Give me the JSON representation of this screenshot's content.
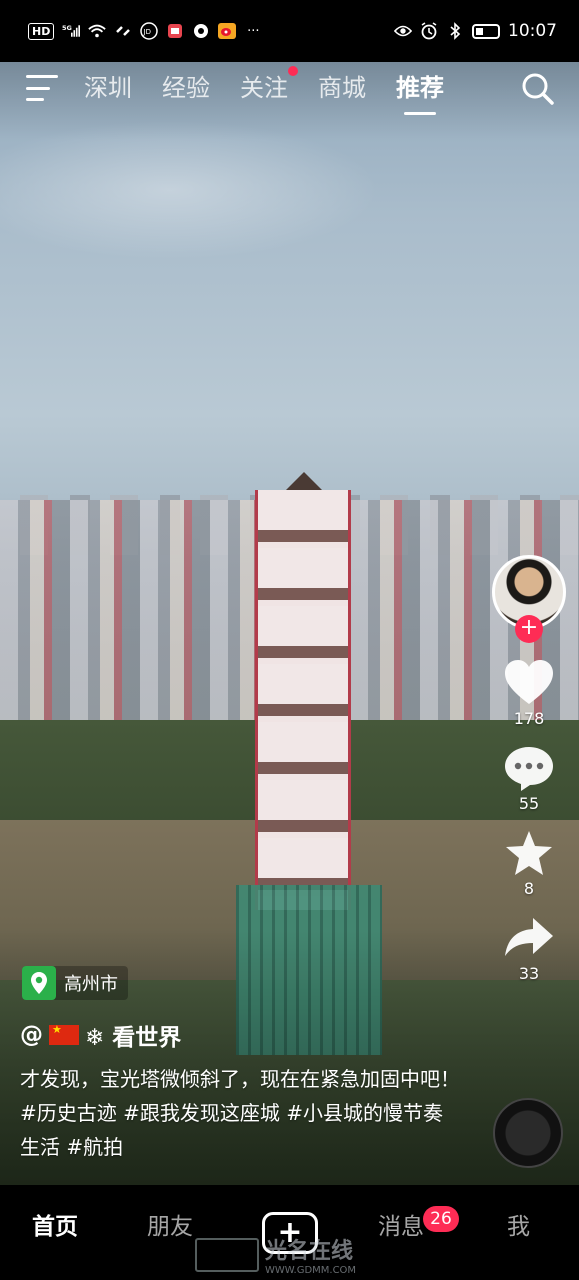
{
  "status_bar": {
    "chips": [
      "HD",
      "5G"
    ],
    "time": "10:07",
    "icons": [
      "signal-icon",
      "wifi-icon",
      "link-icon",
      "jd-icon",
      "app-icon",
      "app-icon",
      "weibo-icon",
      "more-icon",
      "eye-icon",
      "alarm-icon",
      "bluetooth-icon",
      "battery-icon"
    ],
    "more": "···"
  },
  "top_nav": {
    "tabs": [
      {
        "label": "深圳",
        "active": false,
        "dot": false
      },
      {
        "label": "经验",
        "active": false,
        "dot": false
      },
      {
        "label": "关注",
        "active": false,
        "dot": true
      },
      {
        "label": "商城",
        "active": false,
        "dot": false
      },
      {
        "label": "推荐",
        "active": true,
        "dot": false
      }
    ]
  },
  "rail": {
    "follow": "+",
    "like_count": "178",
    "comment_count": "55",
    "favorite_count": "8",
    "share_count": "33"
  },
  "post": {
    "location": "高州市",
    "author": "@🇨🇳❄ 看世界",
    "author_prefix": "@",
    "author_suffix": "❄ 看世界",
    "caption": "才发现，宝光塔微倾斜了，现在在紧急加固中吧！#历史古迹 #跟我发现这座城 #小县城的慢节奏生活 #航拍"
  },
  "bottom_nav": {
    "home": "首页",
    "friends": "朋友",
    "create": "+",
    "messages": "消息",
    "messages_badge": "26",
    "me": "我"
  },
  "watermark": {
    "title": "光名在线",
    "url": "WWW.GDMM.COM"
  },
  "colors": {
    "accent": "#fe2c55",
    "location_green": "#2bb04a"
  }
}
